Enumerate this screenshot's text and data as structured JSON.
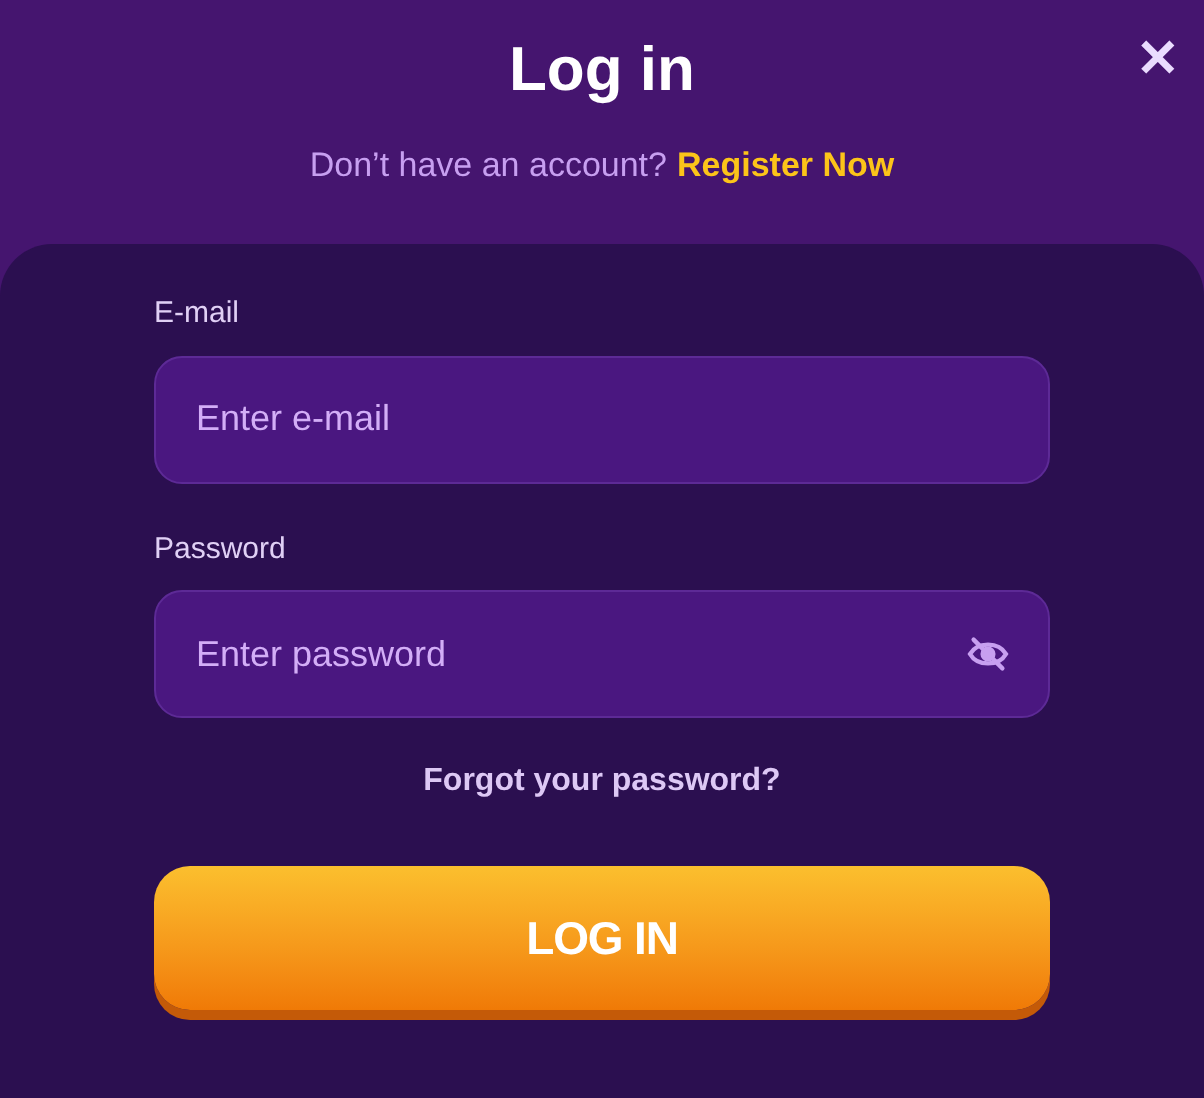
{
  "title": "Log in",
  "close": "✕",
  "register_prompt": {
    "text": "Don’t have an account?",
    "link": "Register Now"
  },
  "fields": [
    {
      "label": "E-mail",
      "placeholder": "Enter e-mail",
      "kind": "email"
    },
    {
      "label": "Password",
      "placeholder": "Enter password",
      "kind": "password"
    }
  ],
  "forgot_link": "Forgot your password?",
  "submit_button": "LOG IN"
}
